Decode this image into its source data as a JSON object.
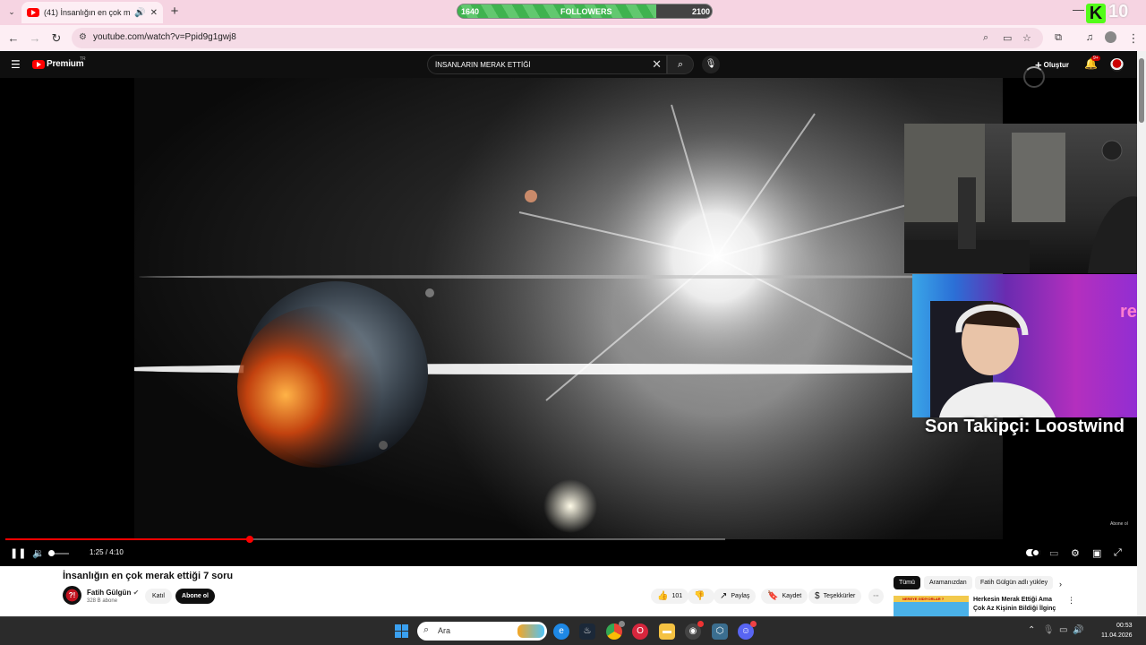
{
  "browser": {
    "tab_title": "(41) İnsanlığın en çok merak",
    "url": "youtube.com/watch?v=Ppid9g1gwj8"
  },
  "overlay": {
    "followers_label": "FOLLOWERS",
    "followers_current": "1640",
    "followers_goal": "2100",
    "followers_progress": 0.78,
    "kick_count": "10",
    "last_follower": "Son Takipçi: Loostwind"
  },
  "youtube": {
    "brand": "Premium",
    "region": "TR",
    "search_query": "İNSANLARIN MERAK ETTİĞİ",
    "create_label": "Oluştur",
    "notifications_badge": "9+"
  },
  "player": {
    "time_display": "1:25 / 4:10",
    "progress": 0.34,
    "watermark": "Abone ol",
    "colors": {
      "progress": "#ff0000"
    }
  },
  "video": {
    "title": "İnsanlığın en çok merak ettiği 7 soru",
    "channel_name": "Fatih Gülgün",
    "channel_initials": "?!",
    "subscribers": "328 B abone",
    "join_label": "Katıl",
    "subscribe_label": "Abone ol",
    "likes": "101",
    "share_label": "Paylaş",
    "save_label": "Kaydet",
    "thanks_label": "Teşekkürler"
  },
  "recommendations": {
    "chips": [
      "Tümü",
      "Aramanızdan",
      "Fatih Gülgün adlı yükley"
    ],
    "first_title": "Herkesin Merak Ettiği Ama Çok Az Kişinin Bildiği İlginç ...",
    "first_thumb_text": "NEREYE GİDİYORLAR ?"
  },
  "taskbar": {
    "search_placeholder": "Ara",
    "time": "00:53",
    "date": "11.04.2026"
  }
}
